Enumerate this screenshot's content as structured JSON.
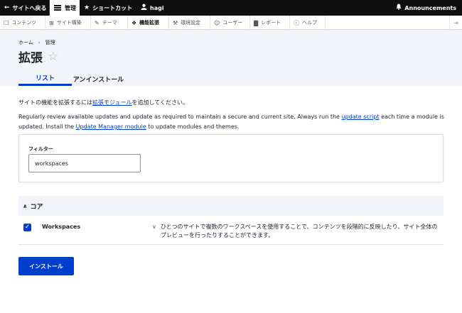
{
  "toolbar": {
    "back_label": "サイトへ戻る",
    "manage_label": "管理",
    "shortcuts_label": "ショートカット",
    "user_label": "hagi",
    "announcements_label": "Announcements"
  },
  "tray": {
    "items": [
      {
        "label": "コンテンツ",
        "icon": "file-icon"
      },
      {
        "label": "サイト構築",
        "icon": "structure-icon"
      },
      {
        "label": "テーマ",
        "icon": "brush-icon"
      },
      {
        "label": "機能拡張",
        "icon": "puzzle-icon"
      },
      {
        "label": "環境設定",
        "icon": "wrench-icon"
      },
      {
        "label": "ユーザー",
        "icon": "people-icon"
      },
      {
        "label": "レポート",
        "icon": "chart-icon"
      },
      {
        "label": "ヘルプ",
        "icon": "help-icon"
      }
    ]
  },
  "breadcrumb": {
    "home": "ホーム",
    "admin": "管理"
  },
  "page": {
    "title": "拡張"
  },
  "tabs": {
    "list": "リスト",
    "uninstall": "アンインストール"
  },
  "intro": {
    "before": "サイトの機能を拡張するには",
    "link": "拡張モジュール",
    "after": "を追加してください。"
  },
  "notice": {
    "part1": "Regularly review available updates and update as required to maintain a secure and current site. Always run the ",
    "link1": "update script",
    "part2": " each time a module is updated. Install the ",
    "link2": "Update Manager module",
    "part3": " to update modules and themes."
  },
  "filter": {
    "label": "フィルター",
    "value": "workspaces"
  },
  "package": {
    "label": "コア"
  },
  "module": {
    "name": "Workspaces",
    "checked": true,
    "description": "ひとつのサイトで複数のワークスペースを使用することで、コンテンツを段階的に反映したり、サイト全体のプレビューを行ったりすることができます。"
  },
  "actions": {
    "install": "インストール"
  },
  "colors": {
    "accent": "#003ecc",
    "toolbar": "#0f0f0f",
    "header_bg": "#f3f4f9"
  }
}
